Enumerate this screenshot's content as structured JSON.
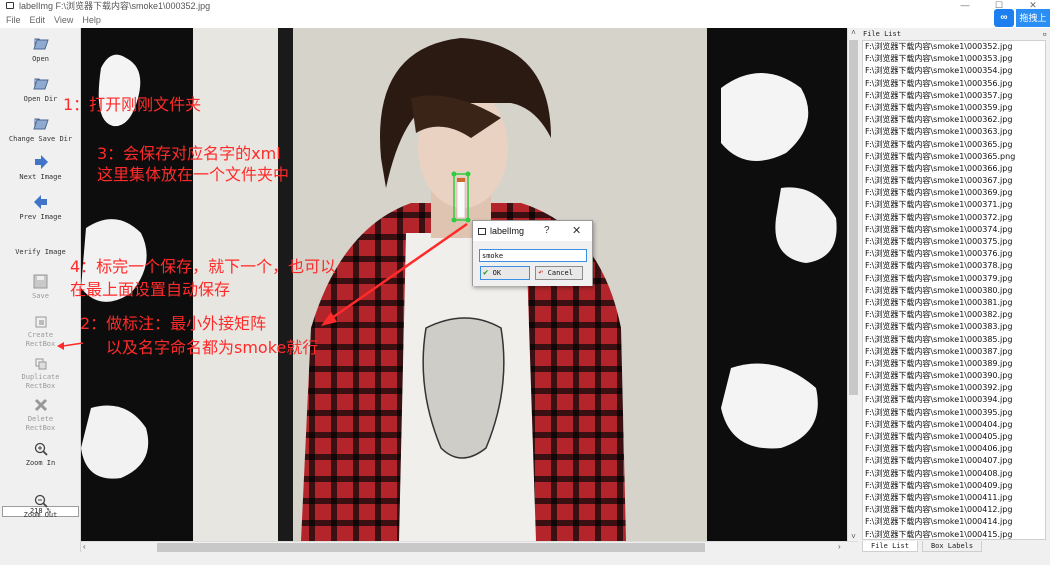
{
  "window": {
    "title": "labelImg F:\\浏览器下载内容\\smoke1\\000352.jpg",
    "min": "—",
    "max": "☐",
    "close": "✕"
  },
  "menu": [
    "File",
    "Edit",
    "View",
    "Help"
  ],
  "baidu": {
    "logo": "∞",
    "label": "拖拽上"
  },
  "toolbar": {
    "open": "Open",
    "open_dir": "Open Dir",
    "change_save_dir": "Change Save Dir",
    "next_image": "Next Image",
    "prev_image": "Prev Image",
    "verify_image": "Verify Image",
    "save": "Save",
    "create_rectbox": [
      "Create",
      "RectBox"
    ],
    "duplicate_rectbox": [
      "Duplicate",
      "RectBox"
    ],
    "delete_rectbox": [
      "Delete",
      "RectBox"
    ],
    "zoom_in": "Zoom In",
    "zoom_value": "218 %",
    "zoom_out": "Zoom Out"
  },
  "annotations": {
    "a1": "1：打开刚刚文件夹",
    "a3_line1": "3：会保存对应名字的xml",
    "a3_line2": "这里集体放在一个文件夹中",
    "a4_line1": "4：标完一个保存，就下一个，也可以",
    "a4_line2": "在最上面设置自动保存",
    "a2_line1": "2：做标注：最小外接矩阵",
    "a2_line2": "以及名字命名都为smoke就行"
  },
  "dialog": {
    "title": "labelImg",
    "help": "?",
    "close": "✕",
    "input_value": "smoke",
    "ok_label": "OK",
    "cancel_label": "Cancel"
  },
  "dock": {
    "title": "File List",
    "files": [
      "F:\\浏览器下载内容\\smoke1\\000352.jpg",
      "F:\\浏览器下载内容\\smoke1\\000353.jpg",
      "F:\\浏览器下载内容\\smoke1\\000354.jpg",
      "F:\\浏览器下载内容\\smoke1\\000356.jpg",
      "F:\\浏览器下载内容\\smoke1\\000357.jpg",
      "F:\\浏览器下载内容\\smoke1\\000359.jpg",
      "F:\\浏览器下载内容\\smoke1\\000362.jpg",
      "F:\\浏览器下载内容\\smoke1\\000363.jpg",
      "F:\\浏览器下载内容\\smoke1\\000365.jpg",
      "F:\\浏览器下载内容\\smoke1\\000365.png",
      "F:\\浏览器下载内容\\smoke1\\000366.jpg",
      "F:\\浏览器下载内容\\smoke1\\000367.jpg",
      "F:\\浏览器下载内容\\smoke1\\000369.jpg",
      "F:\\浏览器下载内容\\smoke1\\000371.jpg",
      "F:\\浏览器下载内容\\smoke1\\000372.jpg",
      "F:\\浏览器下载内容\\smoke1\\000374.jpg",
      "F:\\浏览器下载内容\\smoke1\\000375.jpg",
      "F:\\浏览器下载内容\\smoke1\\000376.jpg",
      "F:\\浏览器下载内容\\smoke1\\000378.jpg",
      "F:\\浏览器下载内容\\smoke1\\000379.jpg",
      "F:\\浏览器下载内容\\smoke1\\000380.jpg",
      "F:\\浏览器下载内容\\smoke1\\000381.jpg",
      "F:\\浏览器下载内容\\smoke1\\000382.jpg",
      "F:\\浏览器下载内容\\smoke1\\000383.jpg",
      "F:\\浏览器下载内容\\smoke1\\000385.jpg",
      "F:\\浏览器下载内容\\smoke1\\000387.jpg",
      "F:\\浏览器下载内容\\smoke1\\000389.jpg",
      "F:\\浏览器下载内容\\smoke1\\000390.jpg",
      "F:\\浏览器下载内容\\smoke1\\000392.jpg",
      "F:\\浏览器下载内容\\smoke1\\000394.jpg",
      "F:\\浏览器下载内容\\smoke1\\000395.jpg",
      "F:\\浏览器下载内容\\smoke1\\000404.jpg",
      "F:\\浏览器下载内容\\smoke1\\000405.jpg",
      "F:\\浏览器下载内容\\smoke1\\000406.jpg",
      "F:\\浏览器下载内容\\smoke1\\000407.jpg",
      "F:\\浏览器下载内容\\smoke1\\000408.jpg",
      "F:\\浏览器下载内容\\smoke1\\000409.jpg",
      "F:\\浏览器下载内容\\smoke1\\000411.jpg",
      "F:\\浏览器下载内容\\smoke1\\000412.jpg",
      "F:\\浏览器下载内容\\smoke1\\000414.jpg",
      "F:\\浏览器下载内容\\smoke1\\000415.jpg"
    ],
    "tabs": [
      "File List",
      "Box Labels"
    ]
  },
  "colors": {
    "annotation": "#ff2a2a",
    "bbox": "#2ecc40",
    "accent": "#3b8fe0"
  }
}
